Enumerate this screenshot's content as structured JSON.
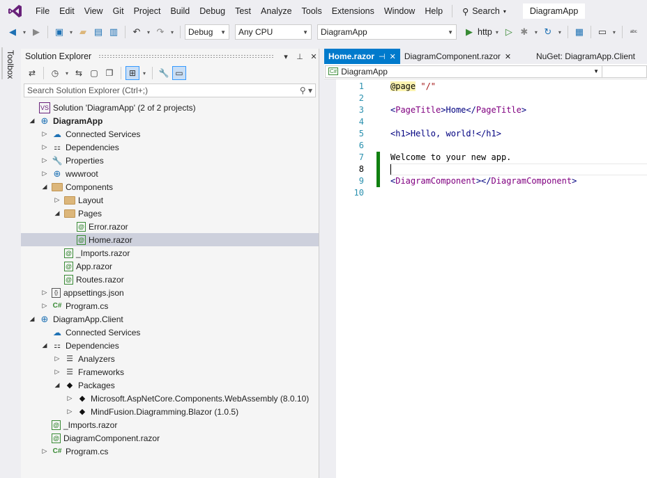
{
  "menubar": {
    "items": [
      "File",
      "Edit",
      "View",
      "Git",
      "Project",
      "Build",
      "Debug",
      "Test",
      "Analyze",
      "Tools",
      "Extensions",
      "Window",
      "Help"
    ],
    "search_label": "Search",
    "app_title": "DiagramApp"
  },
  "toolbar": {
    "configuration": "Debug",
    "platform": "Any CPU",
    "startup_project": "DiagramApp",
    "run_label": "http"
  },
  "toolbox": {
    "label": "Toolbox"
  },
  "solution_explorer": {
    "title": "Solution Explorer",
    "search_placeholder": "Search Solution Explorer (Ctrl+;)",
    "tree": [
      {
        "label": "Solution 'DiagramApp' (2 of 2 projects)",
        "depth": 0,
        "expander": "",
        "icon": "sln",
        "bold": false
      },
      {
        "label": "DiagramApp",
        "depth": 0,
        "expander": "open",
        "icon": "proj",
        "bold": true
      },
      {
        "label": "Connected Services",
        "depth": 1,
        "expander": "closed",
        "icon": "cloud",
        "bold": false
      },
      {
        "label": "Dependencies",
        "depth": 1,
        "expander": "closed",
        "icon": "deps",
        "bold": false
      },
      {
        "label": "Properties",
        "depth": 1,
        "expander": "closed",
        "icon": "props",
        "bold": false
      },
      {
        "label": "wwwroot",
        "depth": 1,
        "expander": "closed",
        "icon": "globe",
        "bold": false
      },
      {
        "label": "Components",
        "depth": 1,
        "expander": "open",
        "icon": "folder",
        "bold": false
      },
      {
        "label": "Layout",
        "depth": 2,
        "expander": "closed",
        "icon": "folder",
        "bold": false
      },
      {
        "label": "Pages",
        "depth": 2,
        "expander": "open",
        "icon": "folder",
        "bold": false
      },
      {
        "label": "Error.razor",
        "depth": 3,
        "expander": "",
        "icon": "razor",
        "bold": false
      },
      {
        "label": "Home.razor",
        "depth": 3,
        "expander": "",
        "icon": "razor",
        "bold": false,
        "selected": true
      },
      {
        "label": "_Imports.razor",
        "depth": 2,
        "expander": "",
        "icon": "razor",
        "bold": false
      },
      {
        "label": "App.razor",
        "depth": 2,
        "expander": "",
        "icon": "razor",
        "bold": false
      },
      {
        "label": "Routes.razor",
        "depth": 2,
        "expander": "",
        "icon": "razor",
        "bold": false
      },
      {
        "label": "appsettings.json",
        "depth": 1,
        "expander": "closed",
        "icon": "json",
        "bold": false
      },
      {
        "label": "Program.cs",
        "depth": 1,
        "expander": "closed",
        "icon": "cs",
        "bold": false
      },
      {
        "label": "DiagramApp.Client",
        "depth": 0,
        "expander": "open",
        "icon": "proj",
        "bold": false
      },
      {
        "label": "Connected Services",
        "depth": 1,
        "expander": "",
        "icon": "cloud",
        "bold": false
      },
      {
        "label": "Dependencies",
        "depth": 1,
        "expander": "open",
        "icon": "deps",
        "bold": false
      },
      {
        "label": "Analyzers",
        "depth": 2,
        "expander": "closed",
        "icon": "anl",
        "bold": false
      },
      {
        "label": "Frameworks",
        "depth": 2,
        "expander": "closed",
        "icon": "anl",
        "bold": false
      },
      {
        "label": "Packages",
        "depth": 2,
        "expander": "open",
        "icon": "pkg",
        "bold": false
      },
      {
        "label": "Microsoft.AspNetCore.Components.WebAssembly (8.0.10)",
        "depth": 3,
        "expander": "closed",
        "icon": "pkg",
        "bold": false
      },
      {
        "label": "MindFusion.Diagramming.Blazor (1.0.5)",
        "depth": 3,
        "expander": "closed",
        "icon": "pkg",
        "bold": false
      },
      {
        "label": "_Imports.razor",
        "depth": 1,
        "expander": "",
        "icon": "razor",
        "bold": false
      },
      {
        "label": "DiagramComponent.razor",
        "depth": 1,
        "expander": "",
        "icon": "razor",
        "bold": false
      },
      {
        "label": "Program.cs",
        "depth": 1,
        "expander": "closed",
        "icon": "cs",
        "bold": false
      }
    ]
  },
  "editor": {
    "tabs": [
      {
        "label": "Home.razor",
        "active": true
      },
      {
        "label": "DiagramComponent.razor",
        "active": false
      },
      {
        "label": "NuGet: DiagramApp.Client",
        "active": false
      }
    ],
    "nav_combo": "DiagramApp",
    "lines": [
      {
        "n": "1",
        "segs": [
          {
            "t": "@page",
            "c": "dir"
          },
          {
            "t": " ",
            "c": ""
          },
          {
            "t": "\"/\"",
            "c": "str"
          }
        ],
        "changed": false
      },
      {
        "n": "2",
        "segs": [],
        "changed": false
      },
      {
        "n": "3",
        "segs": [
          {
            "t": "<",
            "c": "htm"
          },
          {
            "t": "PageTitle",
            "c": "tag"
          },
          {
            "t": ">Home</",
            "c": "htm"
          },
          {
            "t": "PageTitle",
            "c": "tag"
          },
          {
            "t": ">",
            "c": "htm"
          }
        ],
        "changed": false
      },
      {
        "n": "4",
        "segs": [],
        "changed": false
      },
      {
        "n": "5",
        "segs": [
          {
            "t": "<h1>Hello, world!</h1>",
            "c": "htm"
          }
        ],
        "changed": false
      },
      {
        "n": "6",
        "segs": [],
        "changed": false
      },
      {
        "n": "7",
        "segs": [
          {
            "t": "Welcome to your new app.",
            "c": ""
          }
        ],
        "changed": true
      },
      {
        "n": "8",
        "segs": [],
        "changed": true,
        "current": true
      },
      {
        "n": "9",
        "segs": [
          {
            "t": "<",
            "c": "htm"
          },
          {
            "t": "DiagramComponent",
            "c": "tag"
          },
          {
            "t": "></",
            "c": "htm"
          },
          {
            "t": "DiagramComponent",
            "c": "tag"
          },
          {
            "t": ">",
            "c": "htm"
          }
        ],
        "changed": true
      },
      {
        "n": "10",
        "segs": [],
        "changed": false
      }
    ]
  }
}
